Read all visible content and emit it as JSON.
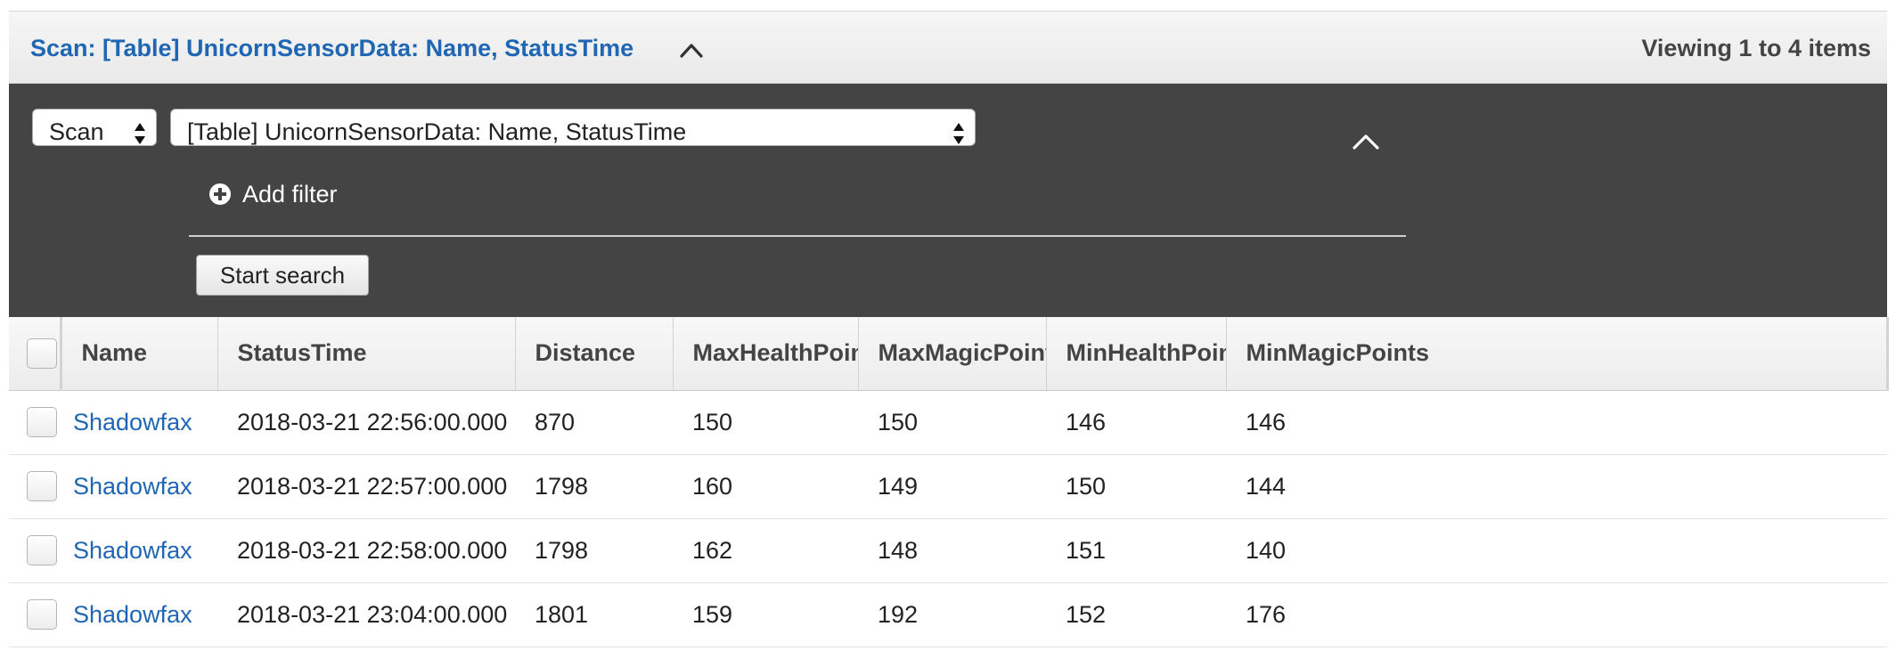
{
  "header": {
    "title": "Scan: [Table] UnicornSensorData: Name, StatusTime",
    "count": "Viewing 1 to 4 items"
  },
  "search": {
    "mode": "Scan",
    "target": "[Table] UnicornSensorData: Name, StatusTime",
    "add_filter_label": "Add filter",
    "start_label": "Start search"
  },
  "table": {
    "columns": [
      "Name",
      "StatusTime",
      "Distance",
      "MaxHealthPoints",
      "MaxMagicPoints",
      "MinHealthPoints",
      "MinMagicPoints"
    ],
    "rows": [
      [
        "Shadowfax",
        "2018-03-21 22:56:00.000",
        "870",
        "150",
        "150",
        "146",
        "146"
      ],
      [
        "Shadowfax",
        "2018-03-21 22:57:00.000",
        "1798",
        "160",
        "149",
        "150",
        "144"
      ],
      [
        "Shadowfax",
        "2018-03-21 22:58:00.000",
        "1798",
        "162",
        "148",
        "151",
        "140"
      ],
      [
        "Shadowfax",
        "2018-03-21 23:04:00.000",
        "1801",
        "159",
        "192",
        "152",
        "176"
      ]
    ]
  },
  "colors": {
    "link": "#1f66b3",
    "dark_panel": "#444444",
    "header_text": "#444444"
  }
}
